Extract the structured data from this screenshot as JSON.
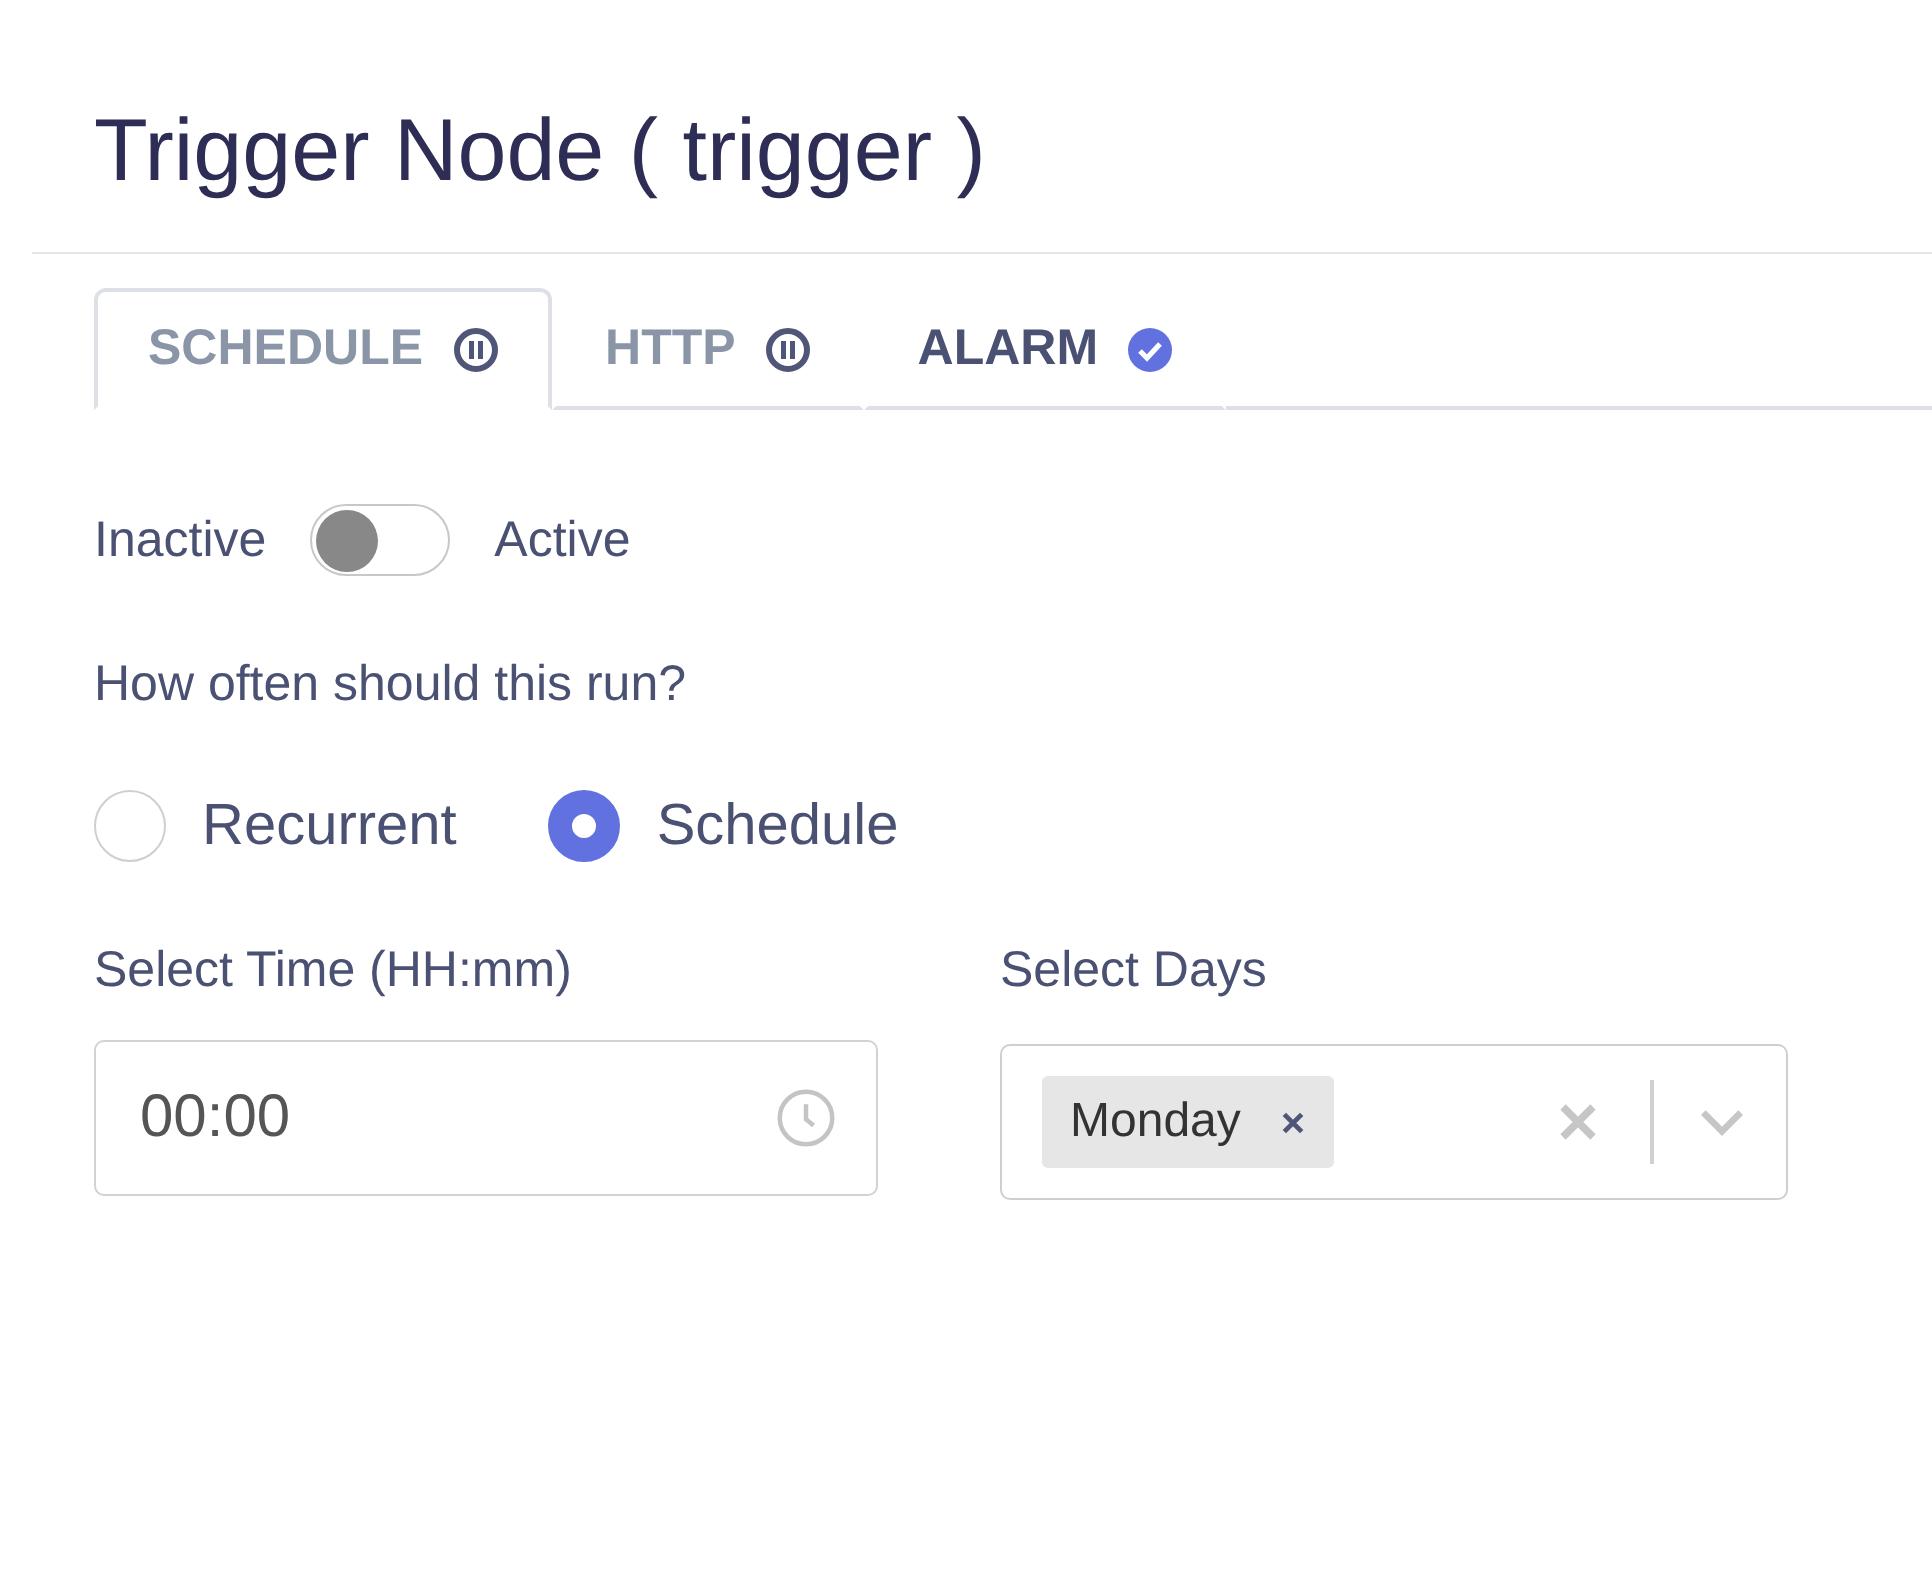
{
  "title": "Trigger Node ( trigger )",
  "tabs": [
    {
      "label": "SCHEDULE",
      "kind": "paused",
      "selected": true
    },
    {
      "label": "HTTP",
      "kind": "paused",
      "selected": false
    },
    {
      "label": "ALARM",
      "kind": "done",
      "selected": false
    }
  ],
  "toggle": {
    "off_label": "Inactive",
    "on_label": "Active",
    "on": false
  },
  "question": "How often should this run?",
  "radios": [
    {
      "label": "Recurrent",
      "selected": false
    },
    {
      "label": "Schedule",
      "selected": true
    }
  ],
  "time_field": {
    "label": "Select Time (HH:mm)",
    "value": "00:00"
  },
  "days_field": {
    "label": "Select Days",
    "tags": [
      "Monday"
    ]
  }
}
